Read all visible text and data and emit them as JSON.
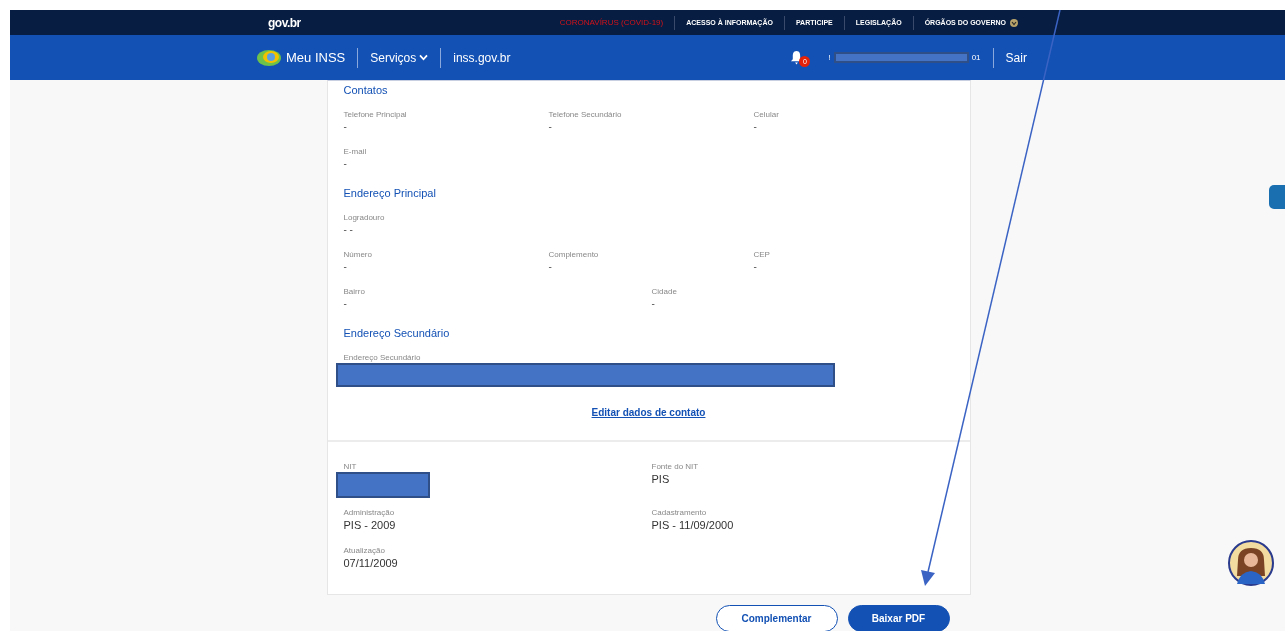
{
  "top_bar": {
    "logo": "gov.br",
    "links": [
      {
        "label": "CORONAVÍRUS (COVID-19)",
        "kind": "alert"
      },
      {
        "label": "ACESSO À INFORMAÇÃO",
        "kind": "link"
      },
      {
        "label": "PARTICIPE",
        "kind": "link"
      },
      {
        "label": "LEGISLAÇÃO",
        "kind": "link"
      },
      {
        "label": "ÓRGÃOS DO GOVERNO",
        "kind": "menu"
      }
    ]
  },
  "header": {
    "brand": "Meu INSS",
    "menu": "Serviços",
    "site": "inss.gov.br",
    "notifications": "0",
    "user_prefix": "!",
    "user_suffix": "01",
    "logout": "Sair"
  },
  "sections": [
    {
      "title": "Contatos",
      "rows": [
        {
          "kind": "thirds",
          "fields": [
            {
              "label": "Telefone Principal",
              "value": "-"
            },
            {
              "label": "Telefone Secundário",
              "value": "-"
            },
            {
              "label": "Celular",
              "value": "-"
            }
          ]
        },
        {
          "kind": "thirds",
          "fields": [
            {
              "label": "E-mail",
              "value": "-"
            }
          ]
        }
      ]
    },
    {
      "title": "Endereço Principal",
      "rows": [
        {
          "kind": "thirds",
          "fields": [
            {
              "label": "Logradouro",
              "value": "- -"
            }
          ]
        },
        {
          "kind": "thirds",
          "fields": [
            {
              "label": "Número",
              "value": "-"
            },
            {
              "label": "Complemento",
              "value": "-"
            },
            {
              "label": "CEP",
              "value": "-"
            }
          ]
        },
        {
          "kind": "halves",
          "fields": [
            {
              "label": "Bairro",
              "value": "-"
            },
            {
              "label": "Cidade",
              "value": "-"
            }
          ]
        }
      ]
    },
    {
      "title": "Endereço Secundário",
      "rows": [
        {
          "kind": "wide",
          "fields": [
            {
              "label": "Endereço Secundário",
              "redacted": true
            }
          ]
        }
      ]
    }
  ],
  "edit_link": "Editar dados de contato",
  "registry": [
    {
      "kind": "halves",
      "fields": [
        {
          "label": "NIT",
          "redacted": true
        },
        {
          "label": "Fonte do NIT",
          "value": "PIS"
        }
      ]
    },
    {
      "kind": "halves",
      "fields": [
        {
          "label": "Administração",
          "value": "PIS - 2009"
        },
        {
          "label": "Cadastramento",
          "value": "PIS - 11/09/2000"
        }
      ]
    },
    {
      "kind": "halves",
      "fields": [
        {
          "label": "Atualização",
          "value": "07/11/2009"
        }
      ]
    }
  ],
  "buttons": [
    {
      "label": "Complementar",
      "kind": "outline"
    },
    {
      "label": "Baixar PDF",
      "kind": "primary"
    }
  ]
}
